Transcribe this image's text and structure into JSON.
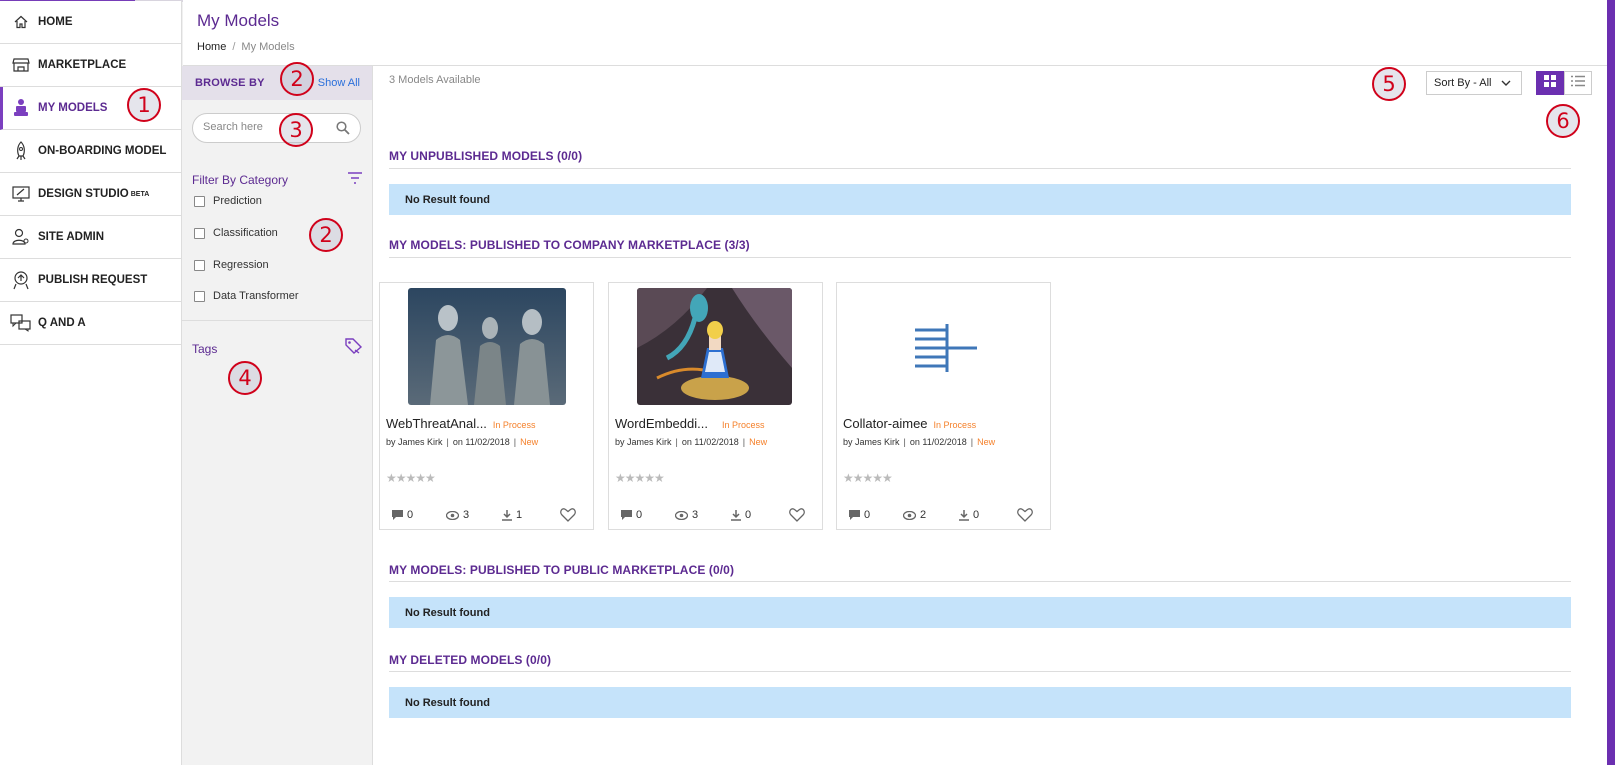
{
  "nav": {
    "items": [
      {
        "label": "HOME",
        "icon": "home-icon"
      },
      {
        "label": "MARKETPLACE",
        "icon": "store-icon"
      },
      {
        "label": "MY MODELS",
        "icon": "my-models-icon",
        "active": true
      },
      {
        "label": "ON-BOARDING MODEL",
        "icon": "rocket-icon"
      },
      {
        "label": "DESIGN STUDIO",
        "icon": "monitor-pen-icon",
        "badge": "BETA"
      },
      {
        "label": "SITE ADMIN",
        "icon": "user-gear-icon"
      },
      {
        "label": "PUBLISH REQUEST",
        "icon": "publish-icon"
      },
      {
        "label": "Q AND A",
        "icon": "chat-icon"
      }
    ]
  },
  "header": {
    "title": "My Models",
    "breadcrumb": {
      "home": "Home",
      "separator": "/",
      "current": "My Models"
    }
  },
  "browse": {
    "label": "BROWSE BY",
    "show_all": "Show All",
    "search_placeholder": "Search here",
    "filter_label": "Filter By Category",
    "categories": [
      "Prediction",
      "Classification",
      "Regression",
      "Data Transformer"
    ],
    "tags_label": "Tags"
  },
  "annotations": [
    "1",
    "2",
    "3",
    "2",
    "4",
    "5",
    "6"
  ],
  "main": {
    "available": "3 Models Available",
    "sort_label": "Sort By - All",
    "sections": [
      {
        "title": "MY UNPUBLISHED MODELS (0/0)",
        "empty": "No Result found"
      },
      {
        "title": "MY MODELS: PUBLISHED TO COMPANY MARKETPLACE (3/3)"
      },
      {
        "title": "MY MODELS: PUBLISHED TO PUBLIC MARKETPLACE (0/0)",
        "empty": "No Result found"
      },
      {
        "title": "MY DELETED MODELS (0/0)",
        "empty": "No Result found"
      }
    ],
    "cards": [
      {
        "name": "WebThreatAnal...",
        "status": "In Process",
        "author": "by James Kirk",
        "date": "on 11/02/2018",
        "tag": "New",
        "rating": "★★★★★",
        "comments": "0",
        "views": "3",
        "downloads": "1"
      },
      {
        "name": "WordEmbeddi...",
        "status": "In Process",
        "author": "by James Kirk",
        "date": "on 11/02/2018",
        "tag": "New",
        "rating": "★★★★★",
        "comments": "0",
        "views": "3",
        "downloads": "0"
      },
      {
        "name": "Collator-aimee",
        "status": "In Process",
        "author": "by James Kirk",
        "date": "on 11/02/2018",
        "tag": "New",
        "rating": "★★★★★",
        "comments": "0",
        "views": "2",
        "downloads": "0"
      }
    ]
  },
  "colors": {
    "brand": "#5c2a91",
    "accent": "#7b3fbf",
    "status": "#f5812b",
    "empty_bg": "#c5e3fa",
    "link": "#2a6fdb",
    "annotation": "#d0021b"
  }
}
